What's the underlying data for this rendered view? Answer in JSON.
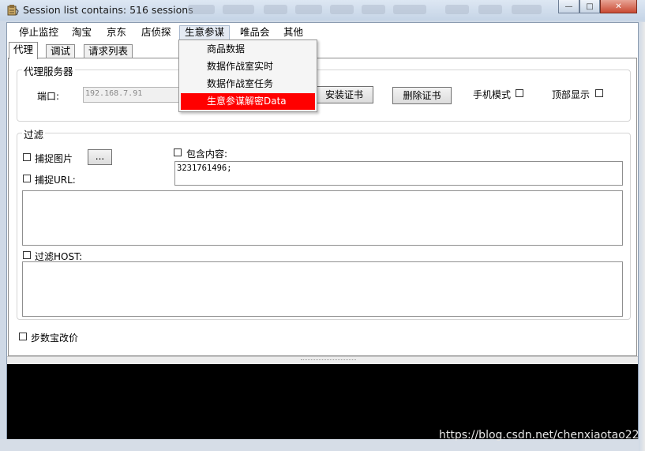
{
  "window": {
    "title": "Session list contains: 516 sessions",
    "controls": {
      "minimize": "—",
      "maximize": "□",
      "close": "✕"
    }
  },
  "menu": {
    "items": [
      "停止监控",
      "淘宝",
      "京东",
      "店侦探",
      "生意参谋",
      "唯品会",
      "其他"
    ],
    "active": "生意参谋",
    "dropdown": [
      "商品数据",
      "数据作战室实时",
      "数据作战室任务",
      "生意参谋解密Data"
    ],
    "dropdown_highlighted": "生意参谋解密Data"
  },
  "tabs": [
    "代理",
    "调试",
    "请求列表"
  ],
  "selected_tab": "代理",
  "proxy_group": {
    "title": "代理服务器",
    "port_label": "端口:",
    "port_value": "192.168.7.91",
    "install_cert": "安装证书",
    "delete_cert": "删除证书",
    "mobile_mode": "手机模式",
    "top_display": "顶部显示"
  },
  "filter_group": {
    "title": "过滤",
    "capture_images": "捕捉图片",
    "ellipsis": "...",
    "capture_url": "捕捉URL:",
    "contains_content": "包含内容:",
    "contains_value": "3231761496;",
    "filter_host": "过滤HOST:"
  },
  "step_price": "步数宝改价",
  "watermark": "https://blog.csdn.net/chenxiaotao22",
  "colors": {
    "highlight": "#ff0000",
    "console_bg": "#000000",
    "title_bar": "#cfd9e6"
  }
}
